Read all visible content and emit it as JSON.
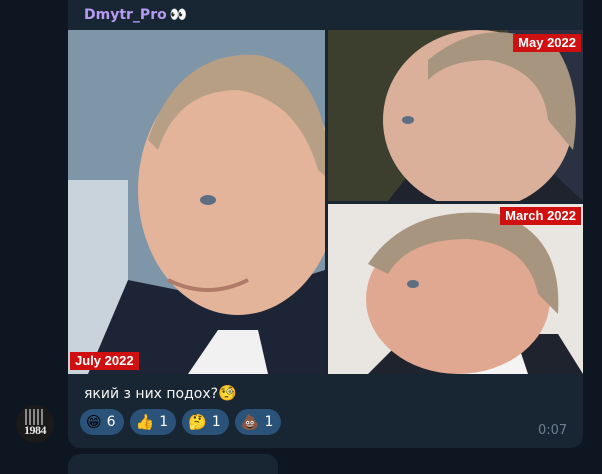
{
  "message": {
    "sender_name": "Dmytr_Pro",
    "sender_emoji": "👀",
    "caption_text": "який з них подох?",
    "caption_emoji": "🧐",
    "time": "0:07"
  },
  "photos": [
    {
      "date_label": "July 2022"
    },
    {
      "date_label": "May 2022"
    },
    {
      "date_label": "March 2022"
    }
  ],
  "reactions": [
    {
      "emoji": "😁",
      "count": "6"
    },
    {
      "emoji": "👍",
      "count": "1"
    },
    {
      "emoji": "🤔",
      "count": "1"
    },
    {
      "emoji": "💩",
      "count": "1"
    }
  ],
  "avatar": {
    "text": "1984"
  },
  "colors": {
    "background": "#0e1621",
    "bubble": "#182533",
    "sender_name": "#b69cf0",
    "reaction_bg": "#2b5278",
    "date_tag": "#d01010",
    "time": "#6d7f8f"
  }
}
